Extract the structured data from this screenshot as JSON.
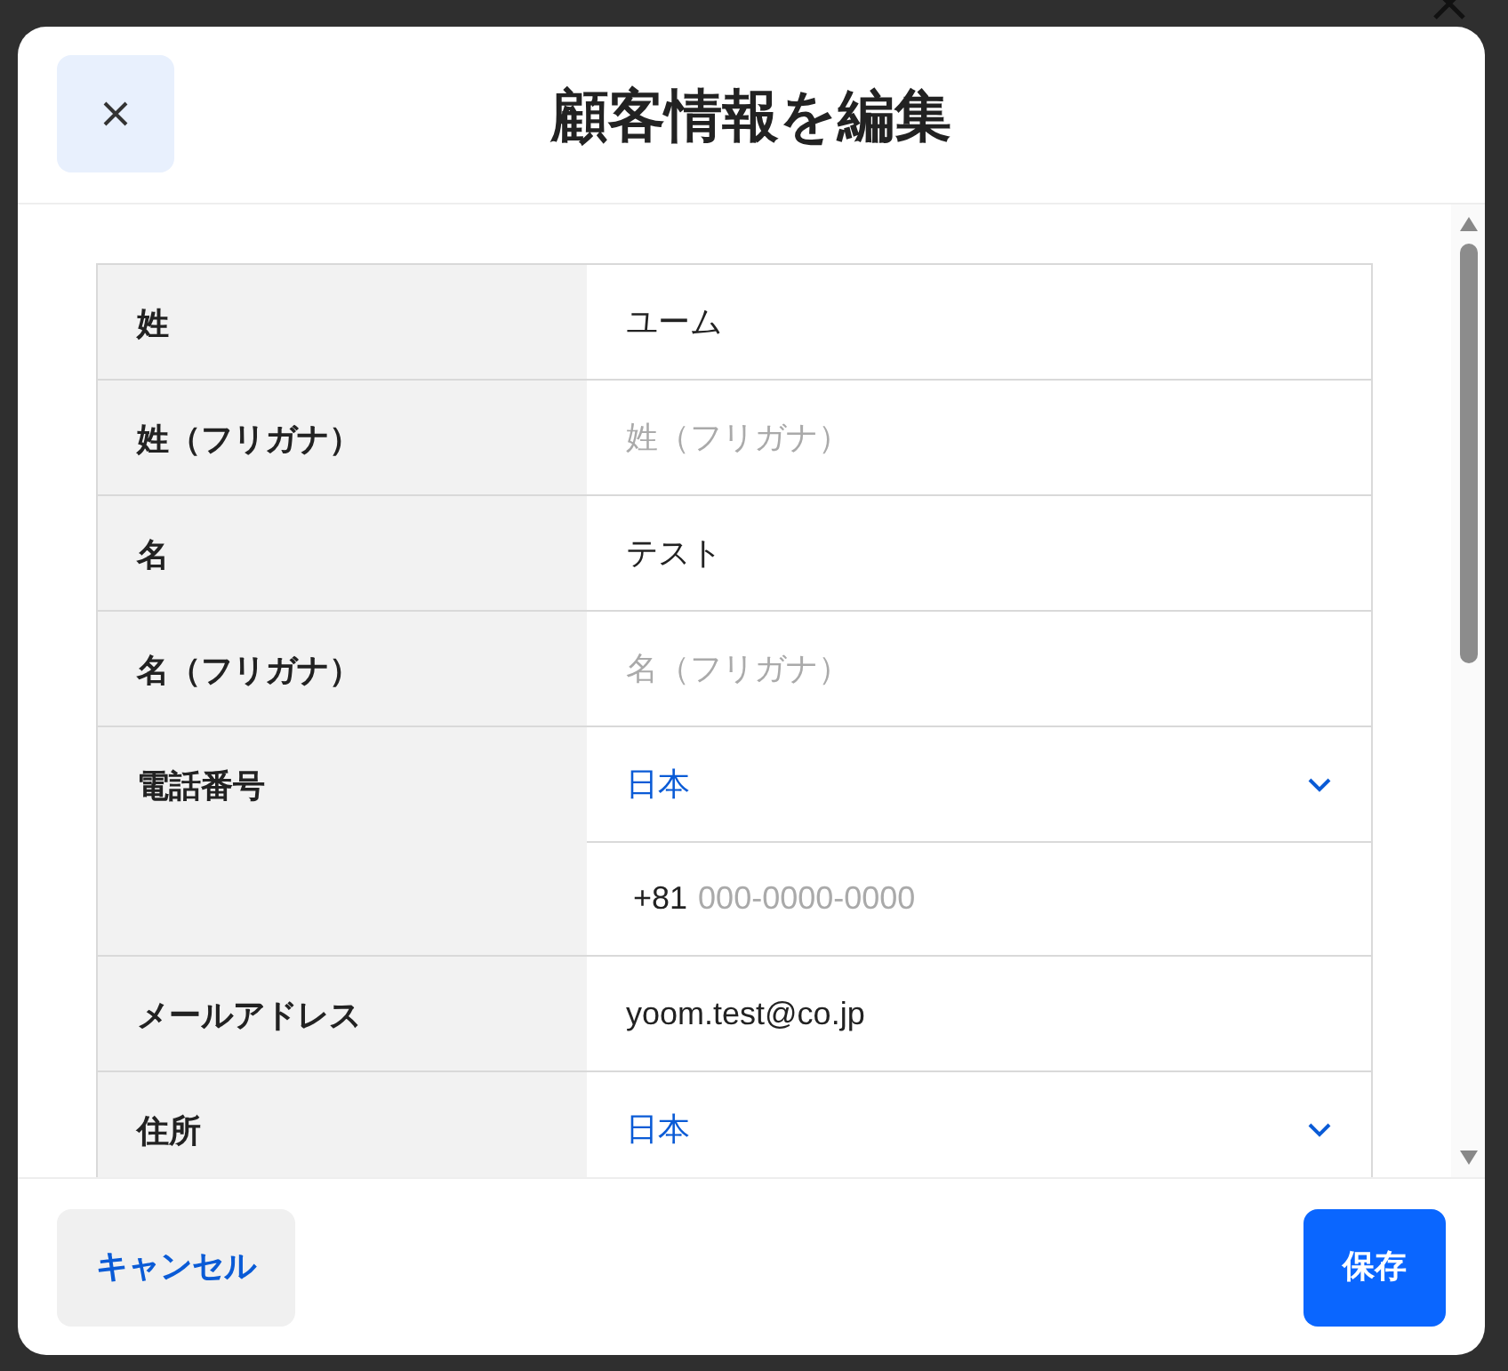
{
  "dialog": {
    "title": "顧客情報を編集"
  },
  "fields": [
    {
      "label": "姓",
      "kind": "text",
      "value": "ユーム"
    },
    {
      "label": "姓（フリガナ）",
      "kind": "text",
      "placeholder": "姓（フリガナ）"
    },
    {
      "label": "名",
      "kind": "text",
      "value": "テスト"
    },
    {
      "label": "名（フリガナ）",
      "kind": "text",
      "placeholder": "名（フリガナ）"
    },
    {
      "label": "電話番号",
      "kind": "phone",
      "country": "日本",
      "prefix": "+81",
      "placeholder": "000-0000-0000"
    },
    {
      "label": "メールアドレス",
      "kind": "text",
      "value": "yoom.test@co.jp"
    },
    {
      "label": "住所",
      "kind": "select",
      "value": "日本"
    }
  ],
  "footer": {
    "cancel": "キャンセル",
    "save": "保存"
  }
}
